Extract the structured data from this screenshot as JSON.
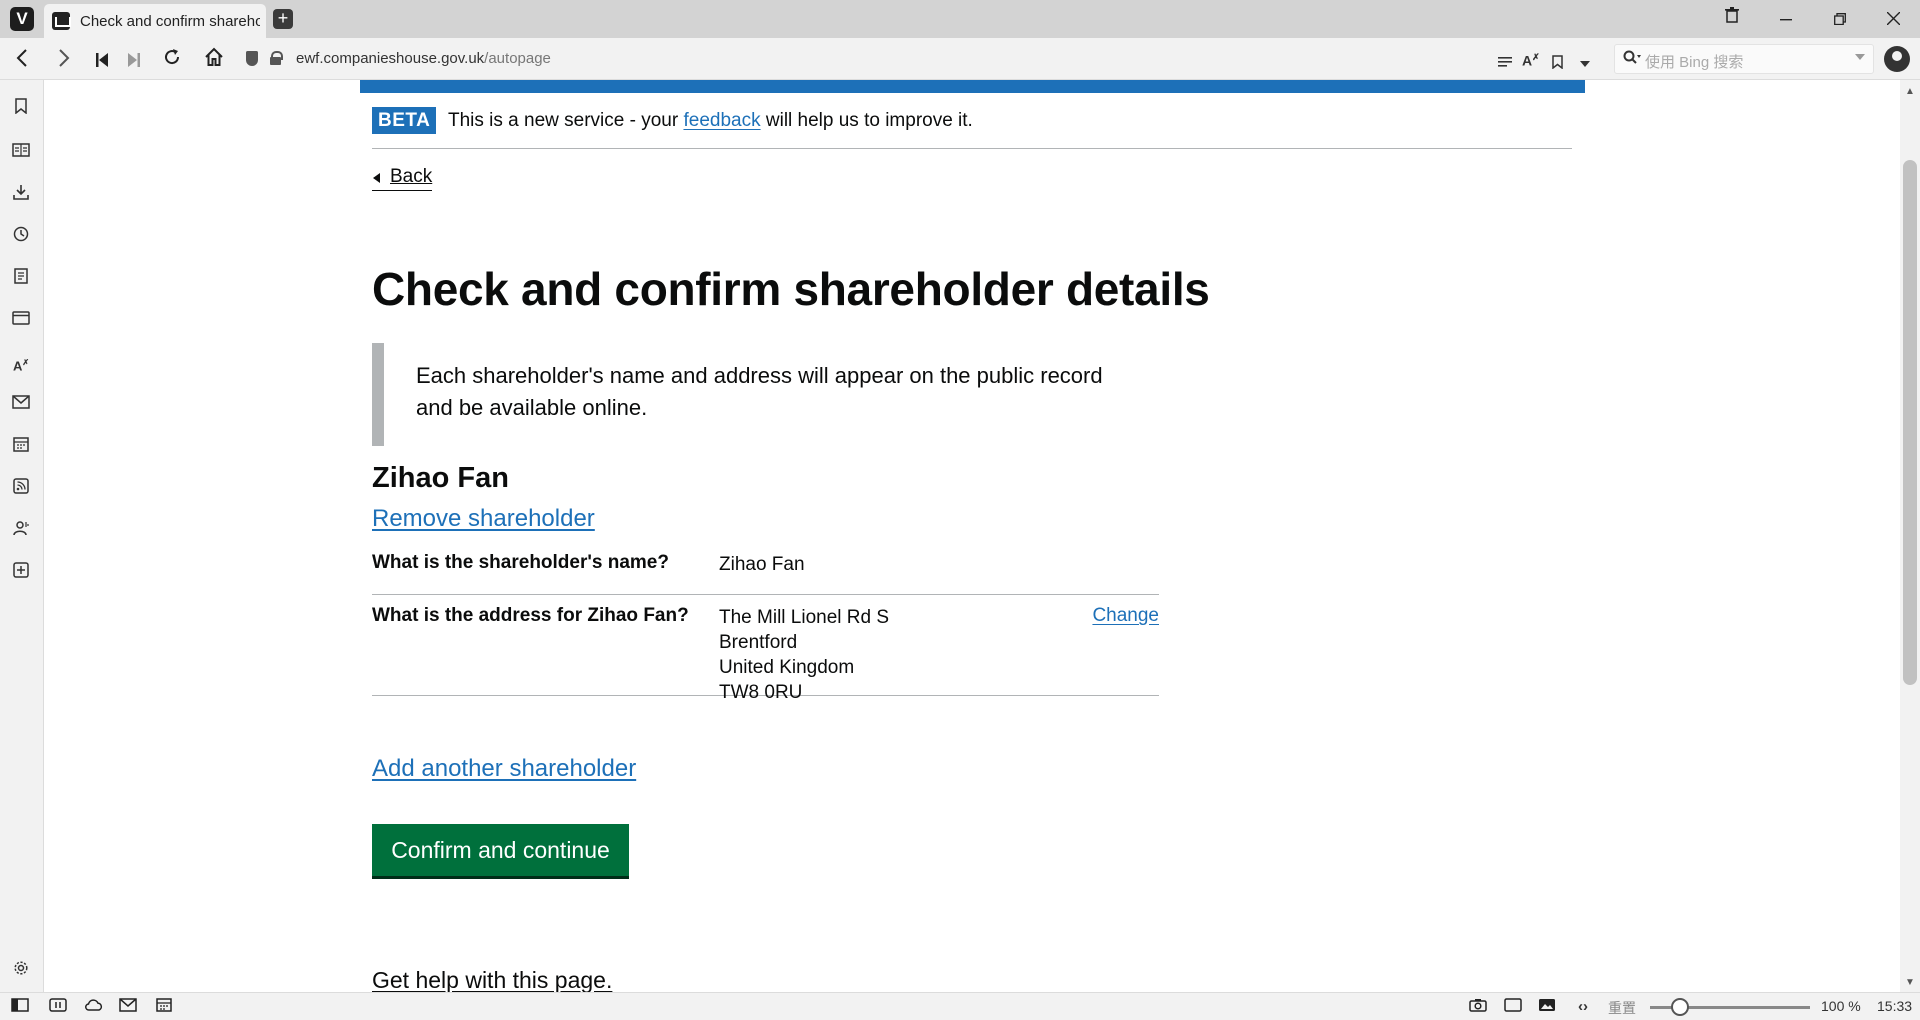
{
  "browser": {
    "tab_title": "Check and confirm shareholder details",
    "new_tab_label": "+",
    "url_domain": "ewf.companieshouse.gov.uk",
    "url_path": "/autopage",
    "search_placeholder": "使用 Bing 搜索",
    "window_controls": {
      "minimize": "—",
      "restore": "❐",
      "close": "✕",
      "trash": "🗑"
    }
  },
  "status_bar": {
    "zoom_label": "重置",
    "zoom_value": "100 %",
    "zoom_level_percent": 100,
    "time": "15:33"
  },
  "page": {
    "phase_tag": "BETA",
    "banner_before": "This is a new service - your ",
    "banner_link": "feedback",
    "banner_after": " will help us to improve it.",
    "back_link": "Back",
    "title": "Check and confirm shareholder details",
    "inset_text": "Each shareholder's name and address will appear on the public record and be available online.",
    "shareholder_name": "Zihao Fan",
    "remove_link": "Remove shareholder",
    "summary": [
      {
        "key": "What is the shareholder's name?",
        "value": [
          "Zihao Fan"
        ],
        "action": ""
      },
      {
        "key": "What is the address for Zihao Fan?",
        "value": [
          "The Mill Lionel Rd S",
          "Brentford",
          "United Kingdom",
          "TW8 0RU"
        ],
        "action": "Change"
      }
    ],
    "add_link": "Add another shareholder",
    "confirm_button": "Confirm and continue",
    "help_link": "Get help with this page."
  },
  "colors": {
    "govuk_blue": "#1d70b8",
    "govuk_green": "#00703c",
    "text": "#0b0c0c",
    "border": "#b1b4b6"
  }
}
